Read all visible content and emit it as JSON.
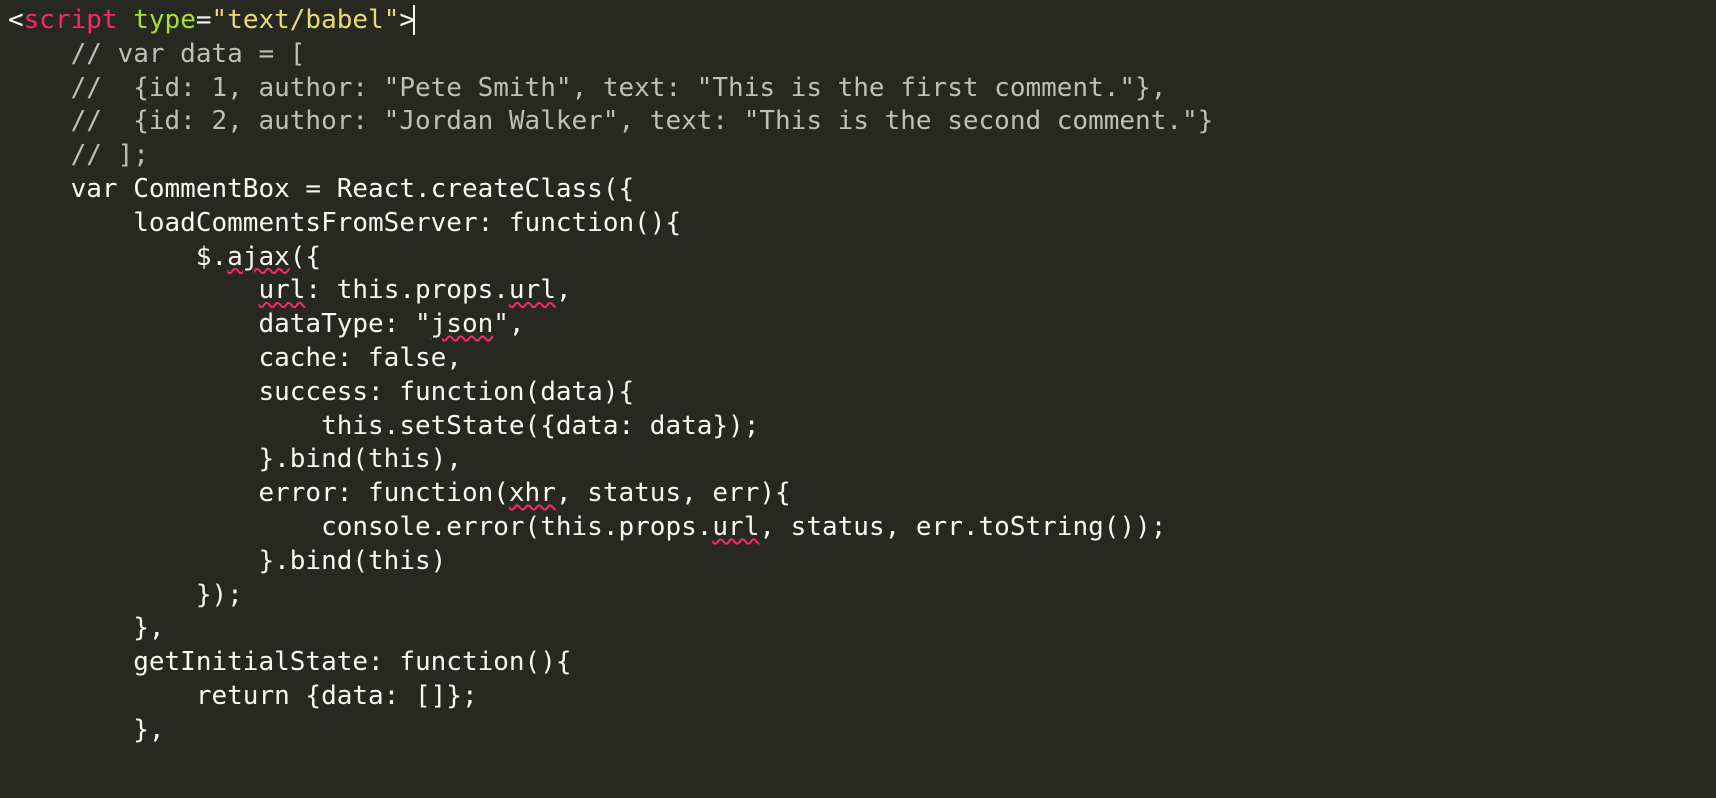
{
  "code": {
    "l1_open": "<",
    "l1_tag": "script",
    "l1_sp": " ",
    "l1_attr": "type",
    "l1_eq": "=",
    "l1_val": "\"text/babel\"",
    "l1_close": ">",
    "l2": "    // var data = [",
    "l3": "    //  {id: 1, author: \"Pete Smith\", text: \"This is the first comment.\"},",
    "l4": "    //  {id: 2, author: \"Jordan Walker\", text: \"This is the second comment.\"}",
    "l5": "    // ];",
    "l6": "    var CommentBox = React.createClass({",
    "l7": "        loadCommentsFromServer: function(){",
    "l8a": "            $.",
    "l8b": "ajax",
    "l8c": "({",
    "l9a": "                ",
    "l9b": "url",
    "l9c": ": this.props.",
    "l9d": "url",
    "l9e": ",",
    "l10a": "                dataType: \"",
    "l10b": "json",
    "l10c": "\",",
    "l11": "                cache: false,",
    "l12": "                success: function(data){",
    "l13": "                    this.setState({data: data});",
    "l14": "                }.bind(this),",
    "l15a": "                error: function(",
    "l15b": "xhr",
    "l15c": ", status, err){",
    "l16a": "                    console.error(this.props.",
    "l16b": "url",
    "l16c": ", status, err.toString());",
    "l17": "                }.bind(this)",
    "l18": "            });",
    "l19": "        },",
    "l20": "        getInitialState: function(){",
    "l21": "            return {data: []};",
    "l22": "        },"
  }
}
